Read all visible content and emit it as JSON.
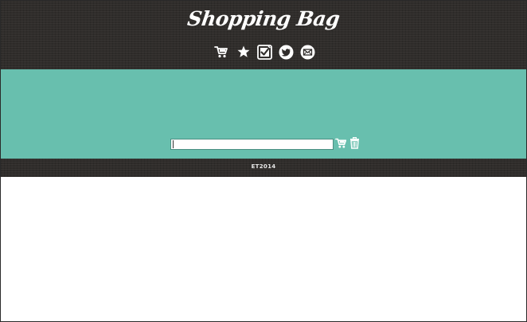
{
  "app": {
    "title": "Shopping Bag"
  },
  "nav": {
    "icons": [
      "cart-icon",
      "star-icon",
      "checklist-icon",
      "twitter-icon",
      "mail-icon"
    ]
  },
  "entry": {
    "input_value": "",
    "add_icon": "cart-add-icon",
    "clear_icon": "trash-icon"
  },
  "footer": {
    "text": "ET2014"
  },
  "colors": {
    "header_bg": "#302d2b",
    "band_bg": "#68bfae",
    "icon": "#ffffff"
  }
}
